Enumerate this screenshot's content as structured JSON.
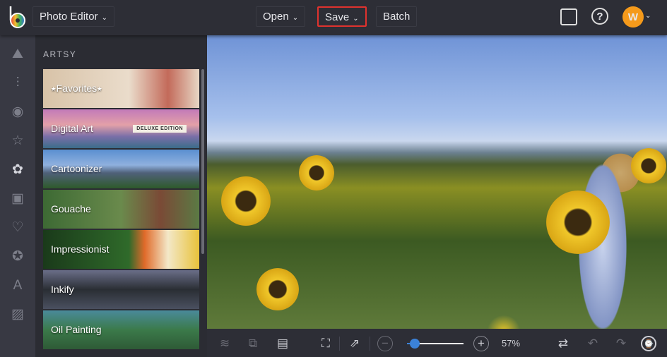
{
  "header": {
    "app_menu": "Photo Editor",
    "open": "Open",
    "save": "Save",
    "batch": "Batch",
    "avatar_initial": "W",
    "accent": "#f59a1b"
  },
  "rail": {
    "icons": [
      "image-icon",
      "adjust-icon",
      "eye-icon",
      "star-icon",
      "effects-icon",
      "frame-icon",
      "heart-icon",
      "badge-icon",
      "text-icon",
      "texture-icon"
    ]
  },
  "panel": {
    "title": "ARTSY",
    "items": [
      {
        "label": "⭑Favorites⭑"
      },
      {
        "label": "Digital Art",
        "badge": "DELUXE EDITION"
      },
      {
        "label": "Cartoonizer"
      },
      {
        "label": "Gouache"
      },
      {
        "label": "Impressionist"
      },
      {
        "label": "Inkify"
      },
      {
        "label": "Oil Painting"
      }
    ]
  },
  "toolbar": {
    "zoom_text": "57%",
    "zoom_fraction": 0.14
  }
}
